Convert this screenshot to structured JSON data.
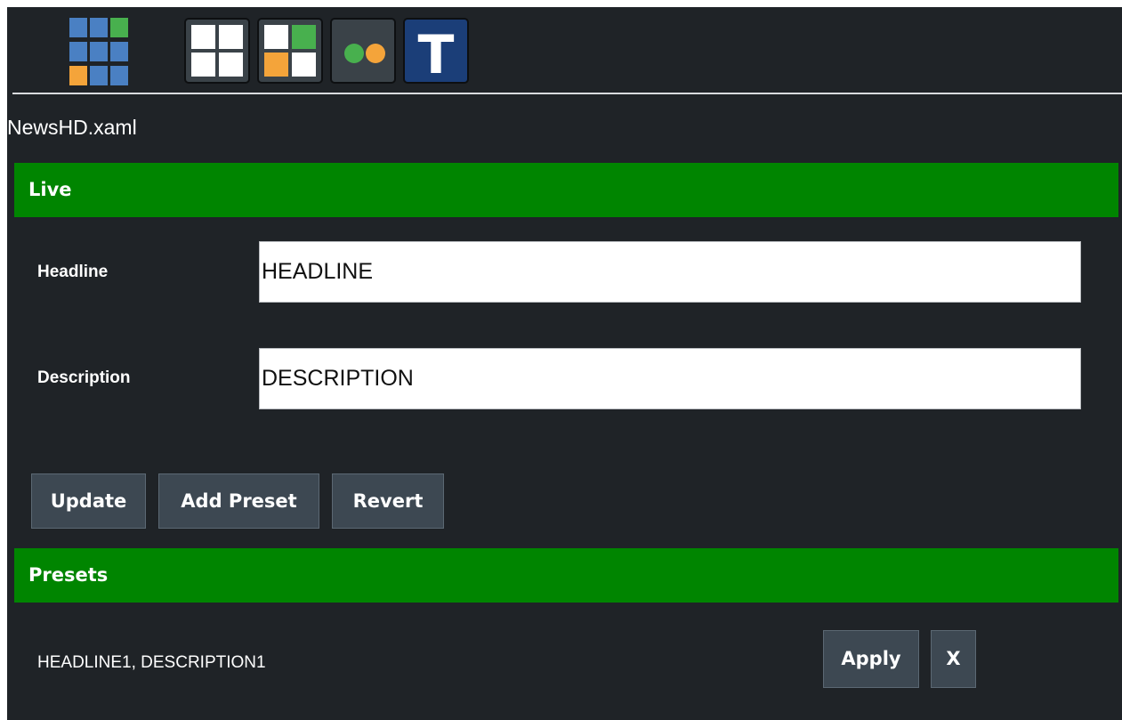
{
  "toolbar": {
    "logo_icon": "grid-logo-icon",
    "buttons": [
      {
        "icon": "layout-four-squares-icon"
      },
      {
        "icon": "layout-colored-squares-icon"
      },
      {
        "icon": "two-dots-icon"
      },
      {
        "icon": "text-t-icon",
        "label": "T"
      }
    ]
  },
  "file": {
    "name": "NewsHD.xaml"
  },
  "live": {
    "title": "Live",
    "fields": [
      {
        "label": "Headline",
        "value": "HEADLINE"
      },
      {
        "label": "Description",
        "value": "DESCRIPTION"
      }
    ],
    "buttons": {
      "update": "Update",
      "add_preset": "Add Preset",
      "revert": "Revert"
    }
  },
  "presets": {
    "title": "Presets",
    "items": [
      {
        "text": "HEADLINE1, DESCRIPTION1",
        "apply_label": "Apply",
        "delete_label": "X"
      }
    ]
  },
  "colors": {
    "background": "#1f2327",
    "section_header": "#008500",
    "button": "#3d4852",
    "logo_blue": "#4a80c3",
    "logo_green": "#48b04e",
    "logo_orange": "#f4a43a",
    "active_tool": "#1b3e78"
  }
}
